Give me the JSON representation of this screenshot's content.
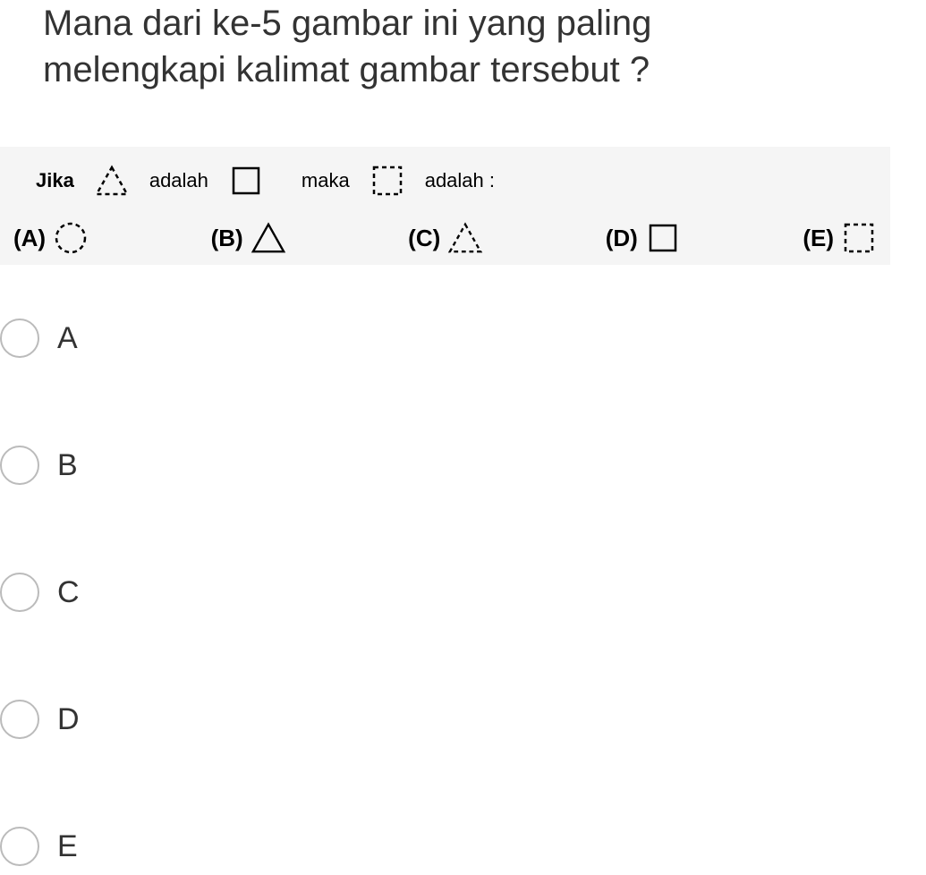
{
  "question": {
    "title_line1": "Mana dari ke-5 gambar ini yang paling",
    "title_line2": "melengkapi kalimat gambar tersebut ?"
  },
  "analogy": {
    "word1": "Jika",
    "shape1": "triangle-dashed",
    "word2": "adalah",
    "shape2": "square-solid",
    "word3": "maka",
    "shape3": "square-dashed",
    "word4": "adalah :"
  },
  "options": [
    {
      "label": "(A)",
      "shape": "circle-dashed"
    },
    {
      "label": "(B)",
      "shape": "triangle-solid"
    },
    {
      "label": "(C)",
      "shape": "triangle-dashed"
    },
    {
      "label": "(D)",
      "shape": "square-solid"
    },
    {
      "label": "(E)",
      "shape": "square-dashed"
    }
  ],
  "answers": [
    {
      "label": "A"
    },
    {
      "label": "B"
    },
    {
      "label": "C"
    },
    {
      "label": "D"
    },
    {
      "label": "E"
    }
  ]
}
